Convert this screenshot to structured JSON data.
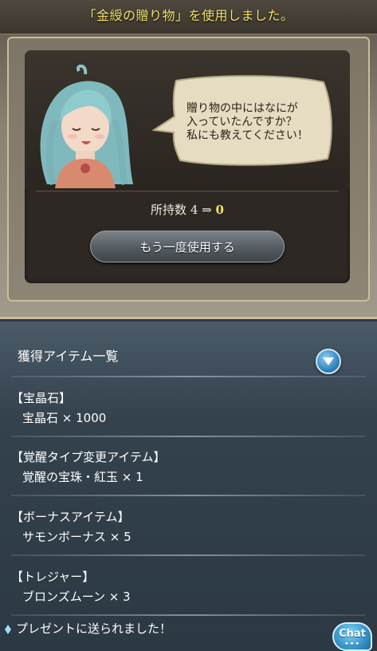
{
  "dialog": {
    "title": "「金綬の贈り物」を使用しました。",
    "speech_lines": [
      "贈り物の中にはなにが",
      "入っていたんですか？",
      "私にも教えてください！"
    ],
    "count_label": "所持数",
    "count_old": "4",
    "count_arrow": "⇒",
    "count_new": "0",
    "use_again_label": "もう一度使用する"
  },
  "items": {
    "header_label": "獲得アイテム一覧",
    "sections": [
      {
        "title": "【宝晶石】",
        "item": "宝晶石 × 1000"
      },
      {
        "title": "【覚醒タイプ変更アイテム】",
        "item": "覚醒の宝珠・紅玉 × 1"
      },
      {
        "title": "【ボーナスアイテム】",
        "item": "サモンボーナス × 5"
      },
      {
        "title": "【トレジャー】",
        "item": "ブロンズムーン × 3"
      }
    ]
  },
  "footer": {
    "present_notice": "プレゼントに送られました！",
    "chat_label": "Chat",
    "chat_dots": "•••"
  },
  "icons": {
    "collapse": "chevron-down-icon",
    "notice": "diamond-icon"
  },
  "colors": {
    "title_text": "#f5e36a",
    "count_new": "#f2e25d",
    "accent_blue": "#2c7fb8"
  }
}
